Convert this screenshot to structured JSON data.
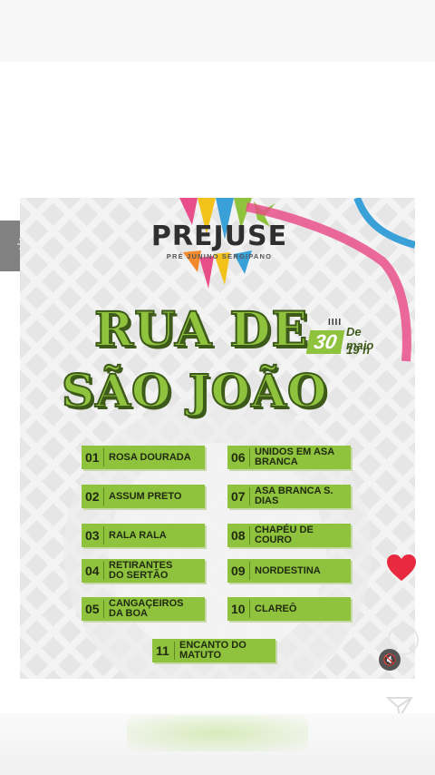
{
  "colors": {
    "green": "#8fc23d",
    "dark_green": "#3d5a1a",
    "heart": "#e8293f"
  },
  "post": {
    "logo": {
      "name": "PREJUSE",
      "subtitle": "PRÉ JUNINO SERGIPANO"
    },
    "headline": {
      "line1": "RUA DE",
      "line2": "SÃO JOÃO"
    },
    "date": {
      "ticks": "IIII",
      "day": "30",
      "month": "De maio",
      "time": "19 h"
    },
    "lineup": [
      {
        "num": "01",
        "label": "ROSA DOURADA"
      },
      {
        "num": "02",
        "label": "ASSUM PRETO"
      },
      {
        "num": "03",
        "label": "RALA RALA"
      },
      {
        "num": "04",
        "label": "RETIRANTES\nDO SERTÃO"
      },
      {
        "num": "05",
        "label": "CANGAÇEIROS\nDA BOA"
      },
      {
        "num": "06",
        "label": "UNIDOS EM ASA\nBRANCA"
      },
      {
        "num": "07",
        "label": "ASA BRANCA S. DIAS"
      },
      {
        "num": "08",
        "label": "CHAPÉU DE COURO"
      },
      {
        "num": "09",
        "label": "NORDESTINA"
      },
      {
        "num": "10",
        "label": "CLAREÔ"
      },
      {
        "num": "11",
        "label": "ENCANTO DO MATUTO"
      }
    ]
  },
  "icons": {
    "side": "sparkle-icon",
    "like": "heart-icon",
    "mute": "mute-icon",
    "share": "send-icon"
  }
}
